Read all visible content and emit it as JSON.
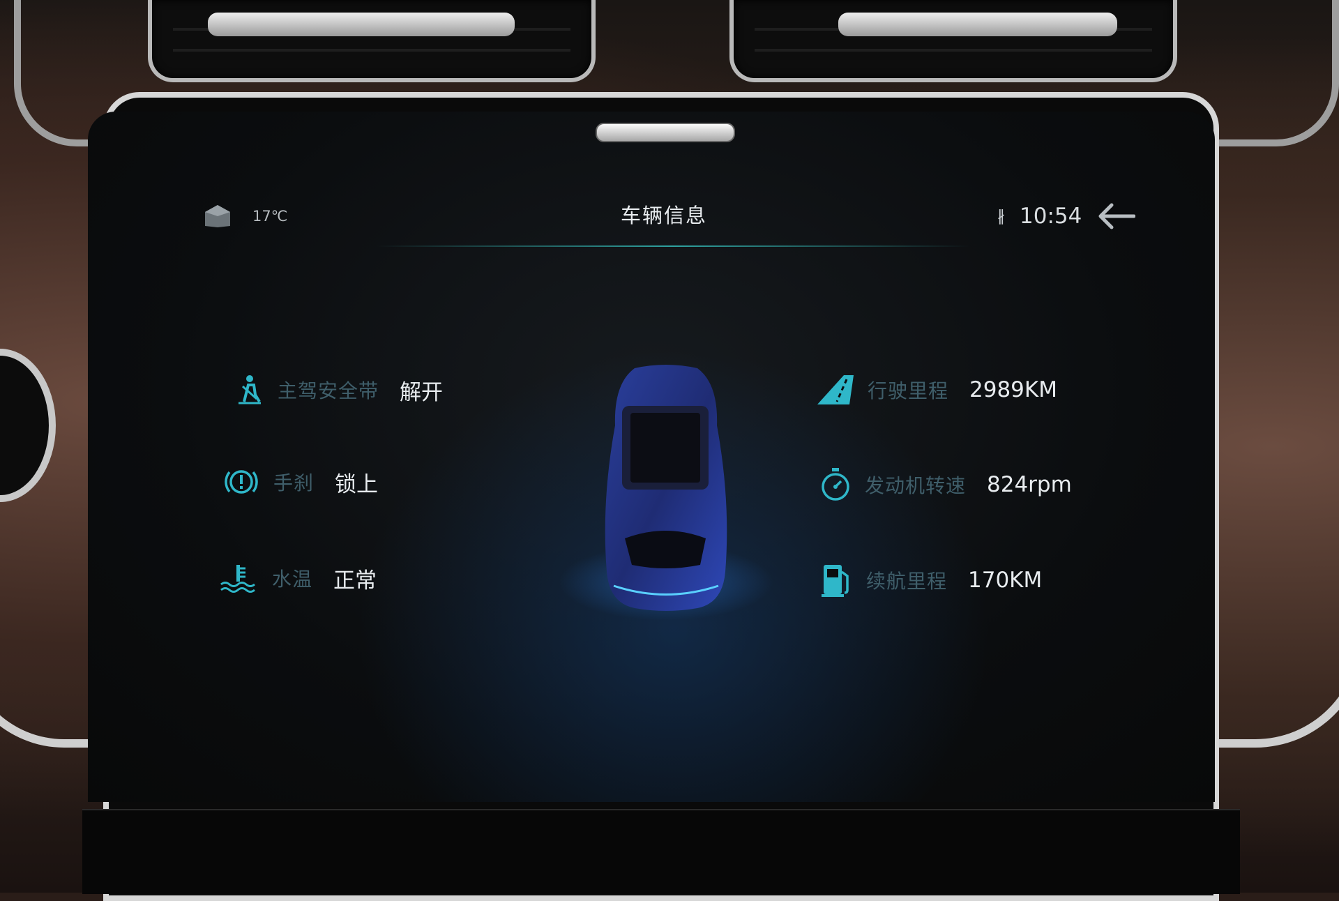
{
  "header": {
    "temperature": "17℃",
    "title": "车辆信息",
    "bluetooth_glyph": "∦",
    "time": "10:54"
  },
  "left_items": [
    {
      "icon": "seatbelt-icon",
      "label": "主驾安全带",
      "value": "解开"
    },
    {
      "icon": "parking-brake-icon",
      "label": "手刹",
      "value": "锁上"
    },
    {
      "icon": "coolant-temp-icon",
      "label": "水温",
      "value": "正常"
    }
  ],
  "right_items": [
    {
      "icon": "road-icon",
      "label": "行驶里程",
      "value": "2989KM"
    },
    {
      "icon": "stopwatch-icon",
      "label": "发动机转速",
      "value": "824rpm"
    },
    {
      "icon": "fuel-pump-icon",
      "label": "续航里程",
      "value": "170KM"
    }
  ],
  "colors": {
    "accent": "#2fb7c9",
    "label": "#3f5e6a",
    "value": "#e8ecef",
    "car": "#2a3f9c"
  }
}
